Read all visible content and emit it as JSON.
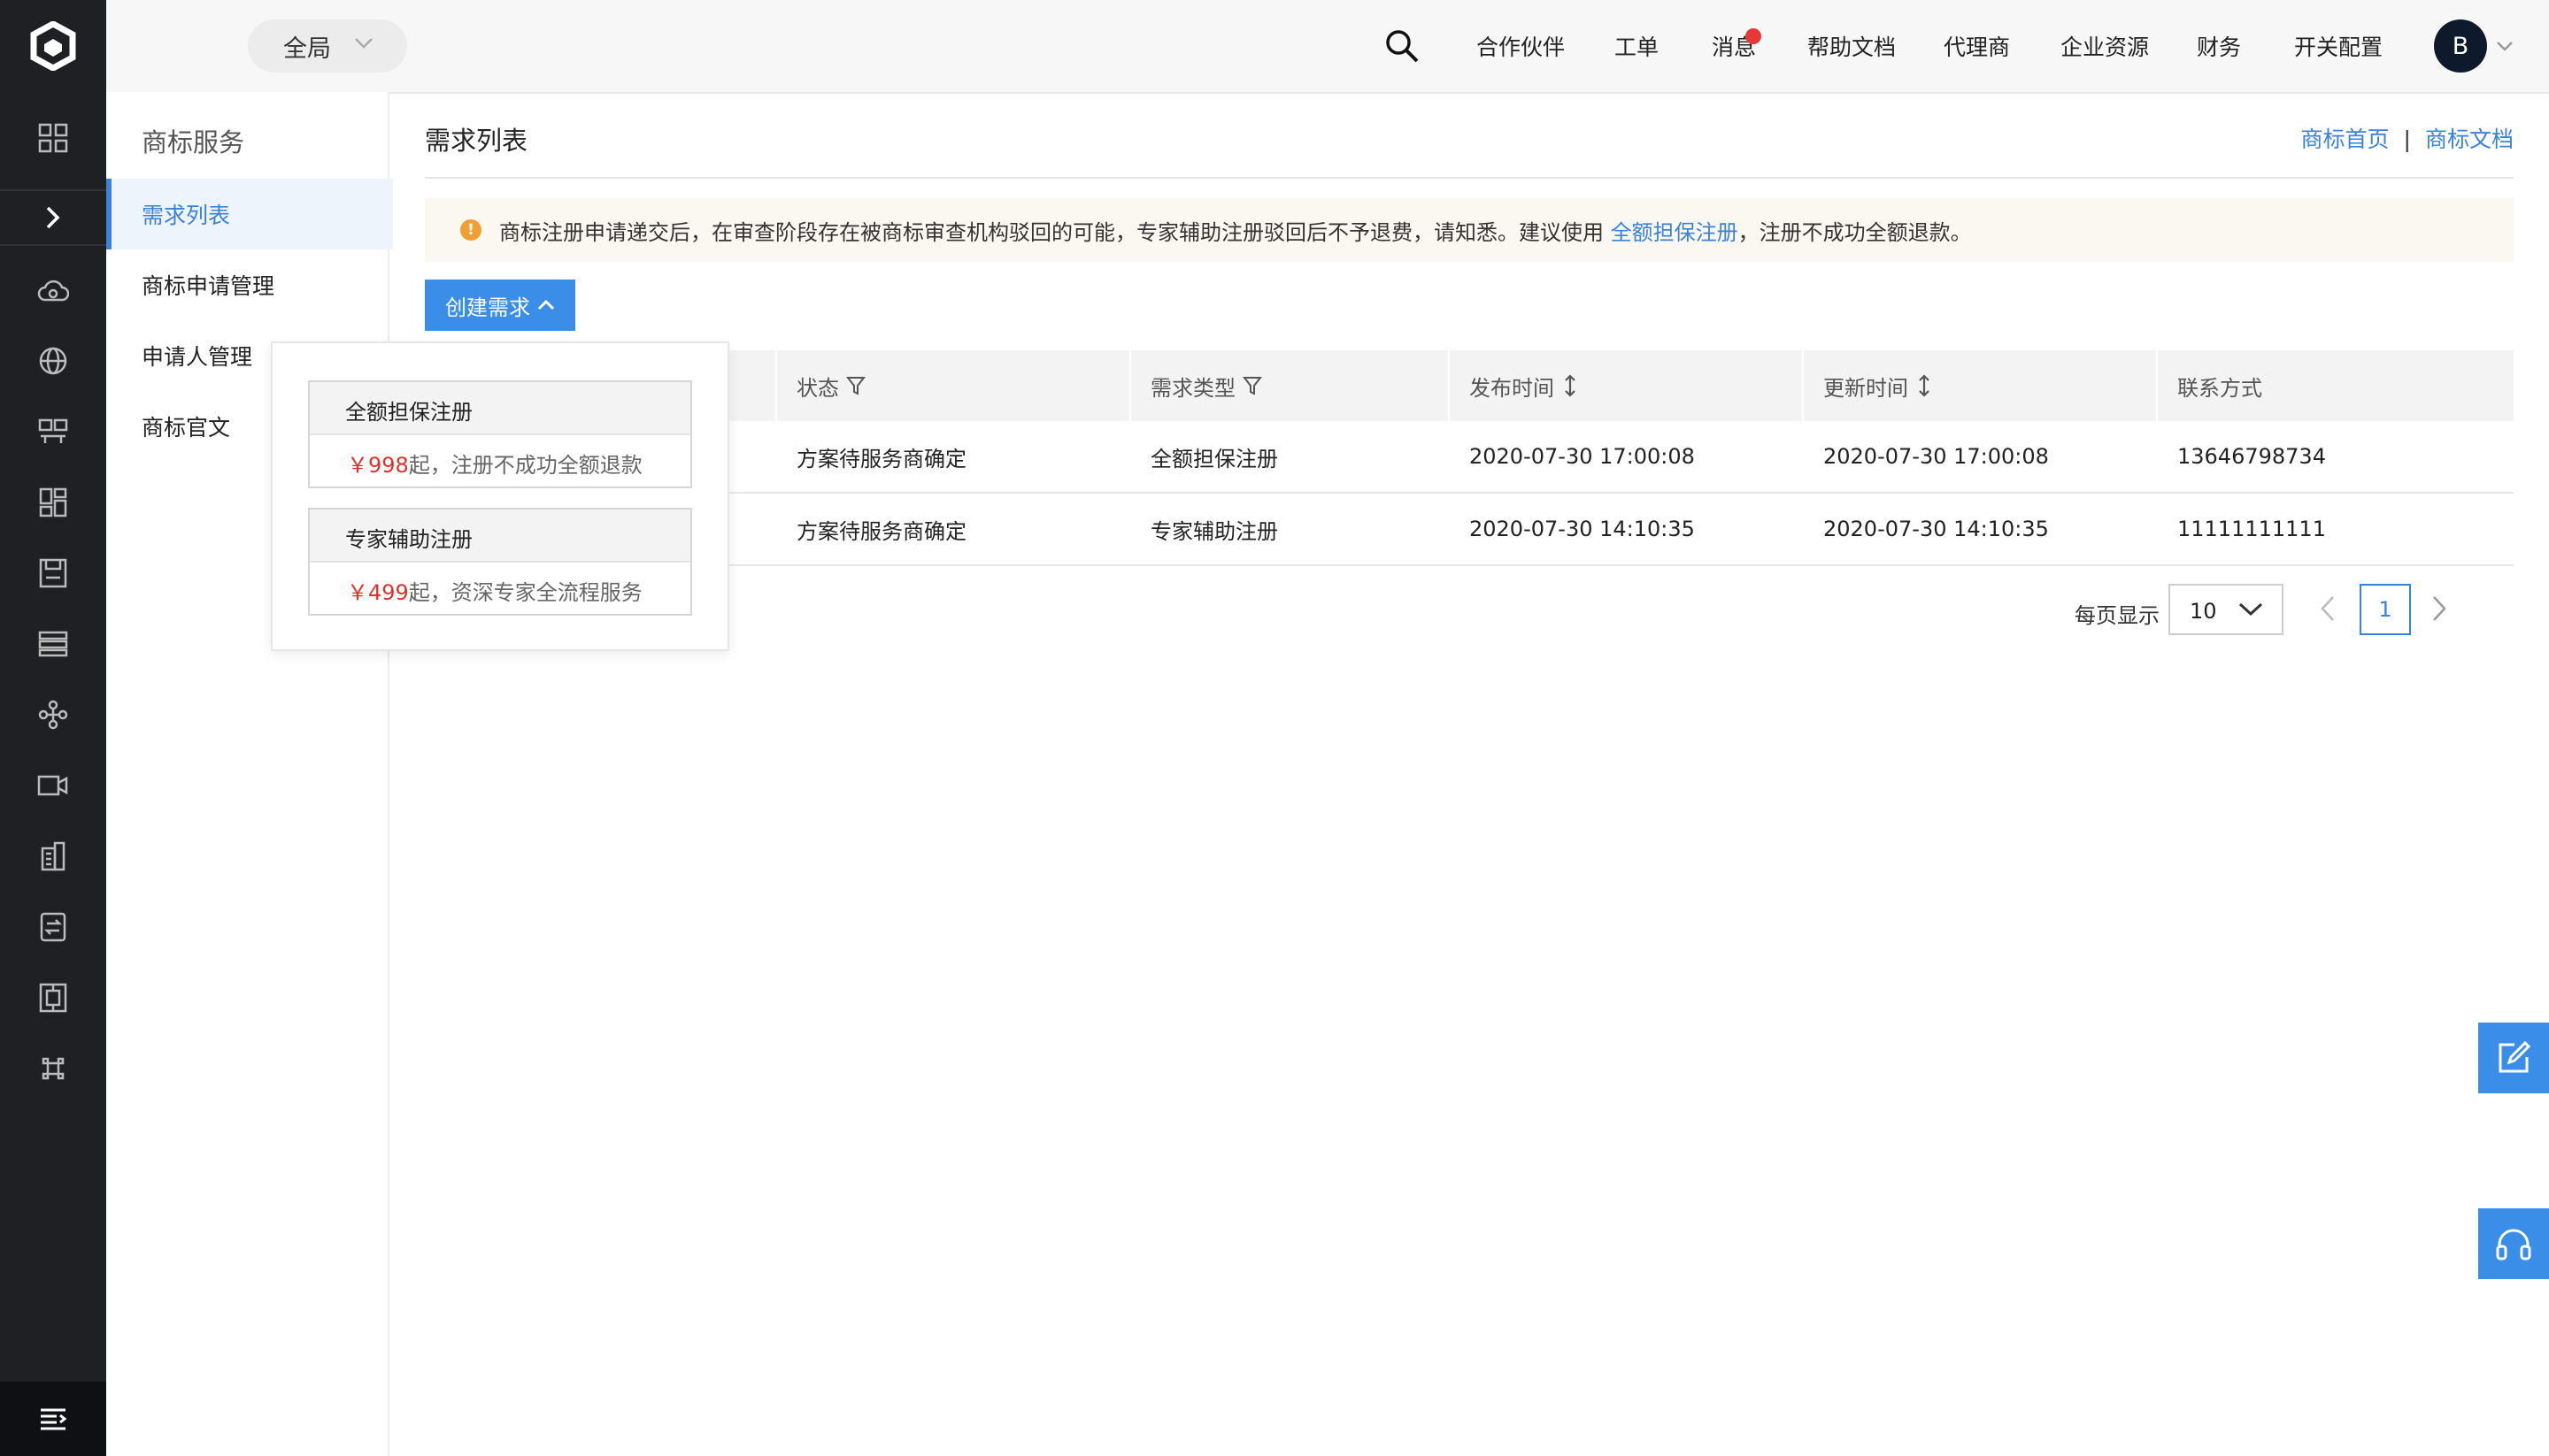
{
  "topbar": {
    "scope": "全局",
    "nav": [
      "合作伙伴",
      "工单",
      "消息",
      "帮助文档",
      "代理商",
      "企业资源",
      "财务",
      "开关配置"
    ],
    "avatar": "B"
  },
  "sidebar": {
    "title": "商标服务",
    "items": [
      {
        "label": "需求列表",
        "active": true
      },
      {
        "label": "商标申请管理"
      },
      {
        "label": "申请人管理"
      },
      {
        "label": "商标官文"
      }
    ]
  },
  "main": {
    "title": "需求列表",
    "links": {
      "home": "商标首页",
      "sep": "|",
      "docs": "商标文档"
    },
    "notice": {
      "before": "商标注册申请递交后，在审查阶段存在被商标审查机构驳回的可能，专家辅助注册驳回后不予退费，请知悉。建议使用 ",
      "link": "全额担保注册",
      "after": "，注册不成功全额退款。"
    },
    "create_button": "创建需求",
    "table": {
      "columns": [
        "状态",
        "需求类型",
        "发布时间",
        "更新时间",
        "联系方式"
      ],
      "rows": [
        [
          "方案待服务商确定",
          "全额担保注册",
          "2020-07-30 17:00:08",
          "2020-07-30 17:00:08",
          "13646798734"
        ],
        [
          "方案待服务商确定",
          "专家辅助注册",
          "2020-07-30 14:10:35",
          "2020-07-30 14:10:35",
          "11111111111"
        ]
      ]
    },
    "pagination": {
      "label": "每页显示",
      "page_size": "10",
      "current": "1"
    }
  },
  "dropdown": {
    "options": [
      {
        "title": "全额担保注册",
        "price": "￥998",
        "desc": "起，注册不成功全额退款"
      },
      {
        "title": "专家辅助注册",
        "price": "￥499",
        "desc": "起，资深专家全流程服务"
      }
    ]
  },
  "colors": {
    "accent": "#3a82d8",
    "button": "#3b8ee8",
    "rail": "#1f2024",
    "price": "#e0322b",
    "warn": "#f0a033",
    "badge": "#e53935"
  },
  "icons": [
    "logo-icon",
    "grid-icon",
    "expand-icon",
    "cloud-icon",
    "globe-icon",
    "monitor-icon",
    "dashboard-icon",
    "save-icon",
    "list-icon",
    "network-icon",
    "video-icon",
    "building-icon",
    "exchange-icon",
    "frame-icon",
    "command-icon",
    "menu-icon",
    "search-icon",
    "edit-icon",
    "headset-icon"
  ]
}
